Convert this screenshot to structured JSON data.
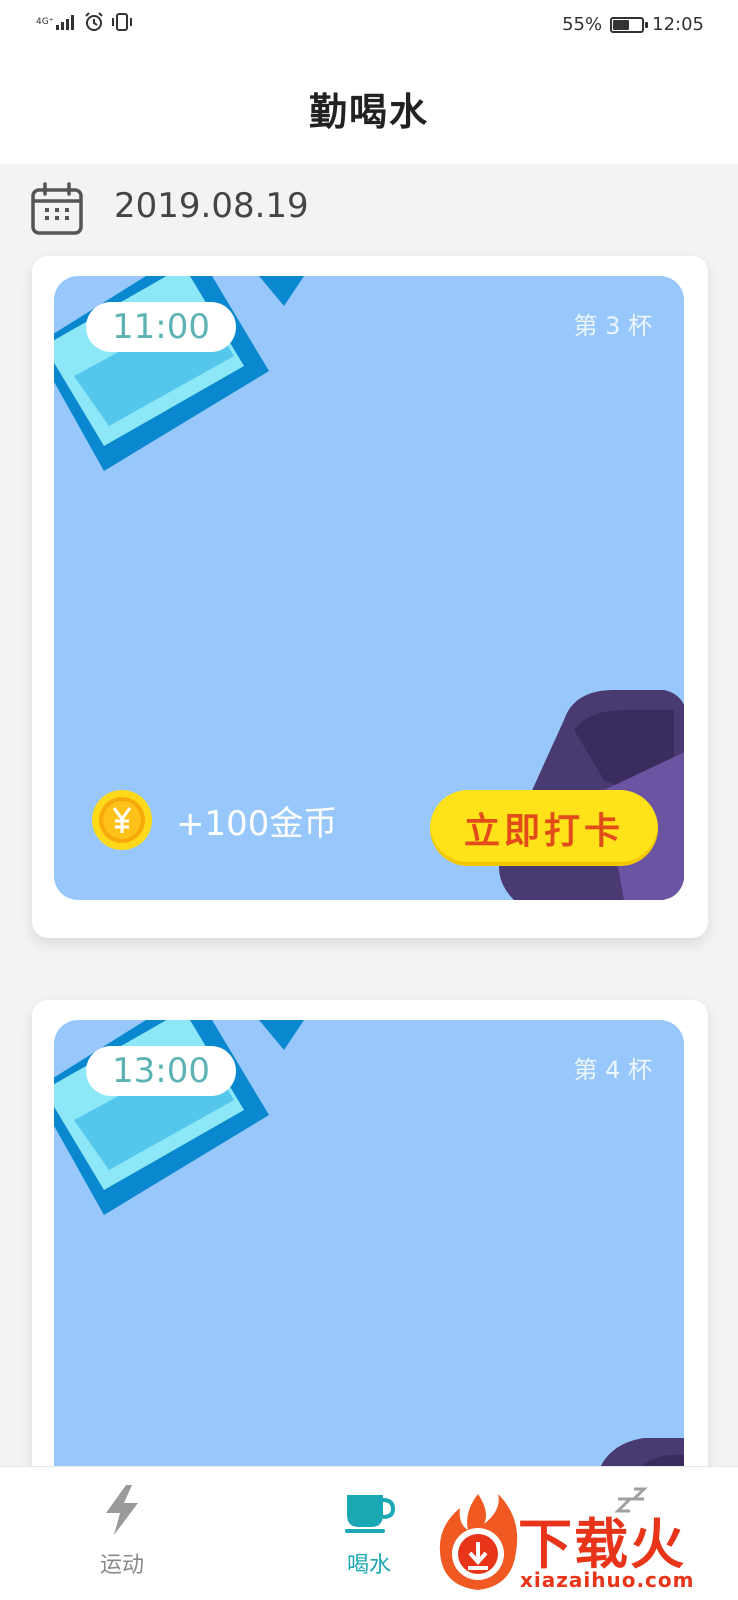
{
  "status_bar": {
    "network": "4G⁺",
    "battery": "55%",
    "battery_level": 0.55,
    "time": "12:05"
  },
  "header": {
    "title": "勤喝水"
  },
  "date_row": {
    "date": "2019.08.19",
    "icon": "calendar-icon"
  },
  "cards": [
    {
      "time": "11:00",
      "cup": "第 3 杯",
      "reward": "+100金币",
      "button": "立即打卡"
    },
    {
      "time": "13:00",
      "cup": "第 4 杯"
    }
  ],
  "bottom_nav": {
    "items": [
      {
        "label": "运动",
        "icon": "lightning-icon",
        "active": false
      },
      {
        "label": "喝水",
        "icon": "cup-icon",
        "active": true
      },
      {
        "label": "",
        "icon": "sleep-icon",
        "active": false
      }
    ],
    "active_color": "#1aa8b5",
    "inactive_color": "#8a8a8a"
  },
  "watermark": {
    "title": "下载火",
    "url": "xiazaihuo.com"
  },
  "colors": {
    "card_background": "#97c7fb",
    "time_text": "#5db3b3",
    "button_background": "#ffe21a",
    "button_text": "#e24b1a"
  }
}
